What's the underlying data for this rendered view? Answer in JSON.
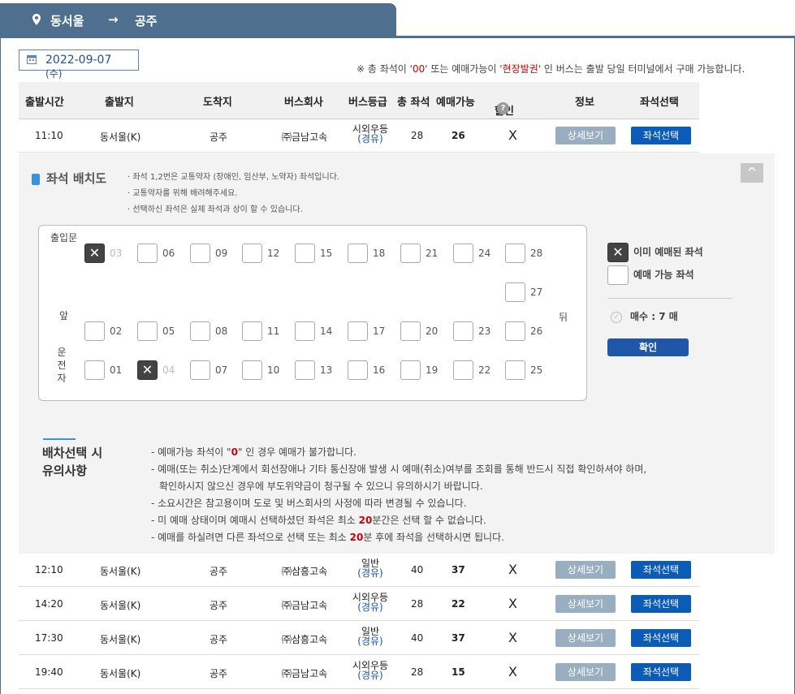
{
  "route": {
    "from": "동서울",
    "arrow": "→",
    "to": "공주"
  },
  "date": {
    "value": "2022-09-07",
    "dow": "(수)"
  },
  "notice": {
    "p1": "※ 총 좌석이 '",
    "hl1": "00",
    "p2": "' 또는 예매가능이 '",
    "hl2": "현장발권",
    "p3": "' 인 버스는 출발 당일 터미널에서 구매 가능합니다."
  },
  "table": {
    "headers": {
      "time": "출발시간",
      "from": "출발지",
      "to": "도착지",
      "company": "버스회사",
      "grade": "버스등급",
      "total": "총 좌석",
      "avail": "예매가능",
      "discount": "할인",
      "info": "정보",
      "seat": "좌석선택"
    },
    "help": "?",
    "detail_label": "상세보기",
    "seat_label": "좌석선택",
    "rows": [
      {
        "time": "11:10",
        "from": "동서울(K)",
        "to": "공주",
        "company": "㈜금남고속",
        "grade": "시외우등",
        "grade_sub": "(경유)",
        "total": "28",
        "avail": "26",
        "discount": "X"
      },
      {
        "time": "12:10",
        "from": "동서울(K)",
        "to": "공주",
        "company": "㈜삼흥고속",
        "grade": "일반",
        "grade_sub": "(경유)",
        "total": "40",
        "avail": "37",
        "discount": "X"
      },
      {
        "time": "14:20",
        "from": "동서울(K)",
        "to": "공주",
        "company": "㈜금남고속",
        "grade": "시외우등",
        "grade_sub": "(경유)",
        "total": "28",
        "avail": "22",
        "discount": "X"
      },
      {
        "time": "17:30",
        "from": "동서울(K)",
        "to": "공주",
        "company": "㈜삼흥고속",
        "grade": "일반",
        "grade_sub": "(경유)",
        "total": "40",
        "avail": "37",
        "discount": "X"
      },
      {
        "time": "19:40",
        "from": "동서울(K)",
        "to": "공주",
        "company": "㈜금남고속",
        "grade": "시외우등",
        "grade_sub": "(경유)",
        "total": "28",
        "avail": "15",
        "discount": "X"
      }
    ]
  },
  "seat_panel": {
    "title": "좌석 배치도",
    "bullets": [
      "좌석 1,2번은 교통약자 (장애인, 임산부, 노약자) 좌석입니다.",
      "교통약자를 위해 배려해주세요.",
      "선택하신 좌석은 실제 좌석과 상이 할 수 있습니다."
    ],
    "close_icon": "^",
    "door": "출입문",
    "front": "앞",
    "back": "뒤",
    "driver": "운전자",
    "booked_mark": "✕",
    "seats": [
      {
        "n": "03",
        "booked": true
      },
      {
        "n": "06",
        "booked": false
      },
      {
        "n": "09",
        "booked": false
      },
      {
        "n": "12",
        "booked": false
      },
      {
        "n": "15",
        "booked": false
      },
      {
        "n": "18",
        "booked": false
      },
      {
        "n": "21",
        "booked": false
      },
      {
        "n": "24",
        "booked": false
      },
      {
        "n": "28",
        "booked": false
      },
      {
        "n": "27",
        "booked": false
      },
      {
        "n": "02",
        "booked": false
      },
      {
        "n": "05",
        "booked": false
      },
      {
        "n": "08",
        "booked": false
      },
      {
        "n": "11",
        "booked": false
      },
      {
        "n": "14",
        "booked": false
      },
      {
        "n": "17",
        "booked": false
      },
      {
        "n": "20",
        "booked": false
      },
      {
        "n": "23",
        "booked": false
      },
      {
        "n": "26",
        "booked": false
      },
      {
        "n": "01",
        "booked": false
      },
      {
        "n": "04",
        "booked": true
      },
      {
        "n": "07",
        "booked": false
      },
      {
        "n": "10",
        "booked": false
      },
      {
        "n": "13",
        "booked": false
      },
      {
        "n": "16",
        "booked": false
      },
      {
        "n": "19",
        "booked": false
      },
      {
        "n": "22",
        "booked": false
      },
      {
        "n": "25",
        "booked": false
      }
    ],
    "legend": {
      "booked": "이미 예매된 좌석",
      "available": "예매 가능 좌석",
      "count_label": "매수 : 7 매",
      "confirm": "확인"
    }
  },
  "caution": {
    "title_1": "배차선택 시",
    "title_2": "유의사항",
    "l1a": "- 예매가능 좌석이 \"",
    "l1b": "0",
    "l1c": "\" 인 경우 예매가 불가합니다.",
    "l2a": "- 예매(또는 취소)단계에서 회선장애나 기타 통신장애 발생 시 예매(취소)여부를 조회를 통해 반드시 직접 확인하셔야 하며,",
    "l2b": "확인하시지 않으신 경우에 부도위약금이 청구될 수 있으니 유의하시기 바랍니다.",
    "l3": "- 소요시간은 참고용이며 도로 및 버스회사의 사정에 따라 변경될 수 있습니다.",
    "l4a": "- 미 예매 상태이며 예매시 선택하셨던 좌석은 최소 ",
    "l4b": "20",
    "l4c": "분간은 선택 할 수 없습니다.",
    "l5a": "- 예매를 하실려면 다른 좌석으로 선택 또는 최소 ",
    "l5b": "20",
    "l5c": "분 후에 좌석을 선택하시면 됩니다."
  }
}
